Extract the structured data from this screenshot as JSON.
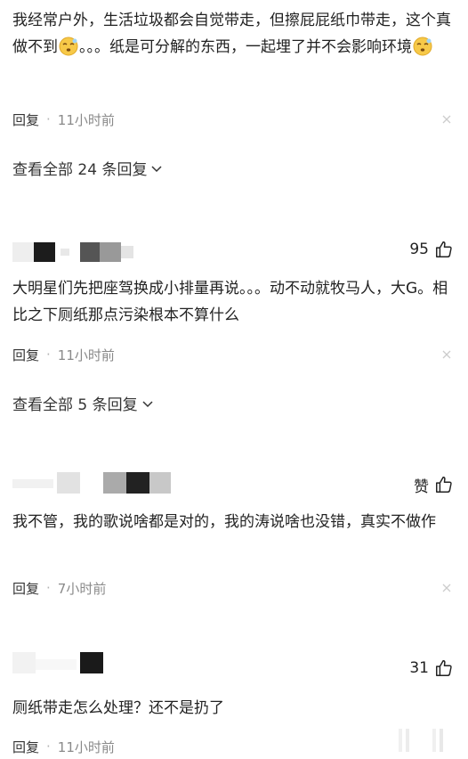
{
  "comments": [
    {
      "text_parts": [
        "我经常户外，生活垃圾都会自觉带走，但擦屁屁纸巾带走，这个真做不到",
        "。。。纸是可分解的东西，一起埋了并不会影响环境"
      ],
      "emoji": "sleepy-face-emoji",
      "reply_label": "回复",
      "separator": "·",
      "time": "11小时前",
      "view_replies": "查看全部 24 条回复"
    },
    {
      "likes": "95",
      "text": "大明星们先把座驾换成小排量再说。。。动不动就牧马人，大G。相比之下厕纸那点污染根本不算什么",
      "reply_label": "回复",
      "separator": "·",
      "time": "11小时前",
      "view_replies": "查看全部 5 条回复"
    },
    {
      "likes": "赞",
      "text": "我不管，我的歌说啥都是对的，我的涛说啥也没错，真实不做作",
      "reply_label": "回复",
      "separator": "·",
      "time": "7小时前"
    },
    {
      "likes": "31",
      "text": "厕纸带走怎么处理？还不是扔了",
      "reply_label": "回复",
      "separator": "·",
      "time": "11小时前"
    }
  ],
  "icons": {
    "thumb": "thumbs-up-icon",
    "close": "close-icon",
    "chevron": "chevron-down-icon"
  },
  "colors": {
    "text": "#222222",
    "muted": "#8a8a8a",
    "close": "#cccccc"
  }
}
